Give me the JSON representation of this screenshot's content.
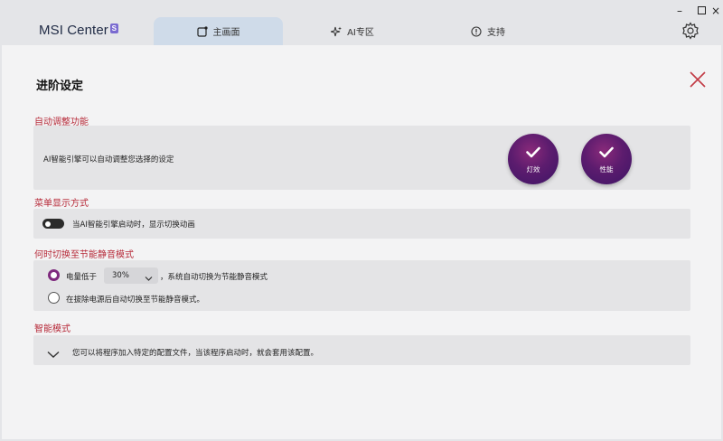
{
  "app": {
    "brand": "MSI Center",
    "brand_badge": "S"
  },
  "tabs": [
    {
      "label": "主画面",
      "icon": "home-icon",
      "active": true
    },
    {
      "label": "AI专区",
      "icon": "ai-sparkle-icon",
      "active": false
    },
    {
      "label": "支持",
      "icon": "info-icon",
      "active": false
    }
  ],
  "window_controls": {
    "minimize": "–",
    "maximize": "□",
    "close": "×"
  },
  "page": {
    "title": "进阶设定"
  },
  "sections": {
    "ai": {
      "label": "自动调整功能",
      "description": "AI智能引擎可以自动调整您选择的设定",
      "options": [
        {
          "label": "灯效",
          "checked": true
        },
        {
          "label": "性能",
          "checked": true
        }
      ]
    },
    "menu": {
      "label": "菜单显示方式",
      "toggle_text": "当AI智能引擎启动时，显示切换动画",
      "toggle_on": false
    },
    "power": {
      "label": "何时切换至节能静音模式",
      "option1_prefix": "电量低于",
      "option1_value": "30%",
      "option1_suffix": "，系统自动切换为节能静音模式",
      "option2_text": "在拔除电源后自动切换至节能静音模式。",
      "selected": 1
    },
    "smart": {
      "label": "智能模式",
      "text": "您可以将程序加入特定的配置文件，当该程序启动时，就会套用该配置。"
    }
  },
  "colors": {
    "accent": "#b72b3a",
    "radio": "#7f2a7e",
    "circle": "#5c1c6e",
    "active_tab": "#cfdbe9"
  }
}
